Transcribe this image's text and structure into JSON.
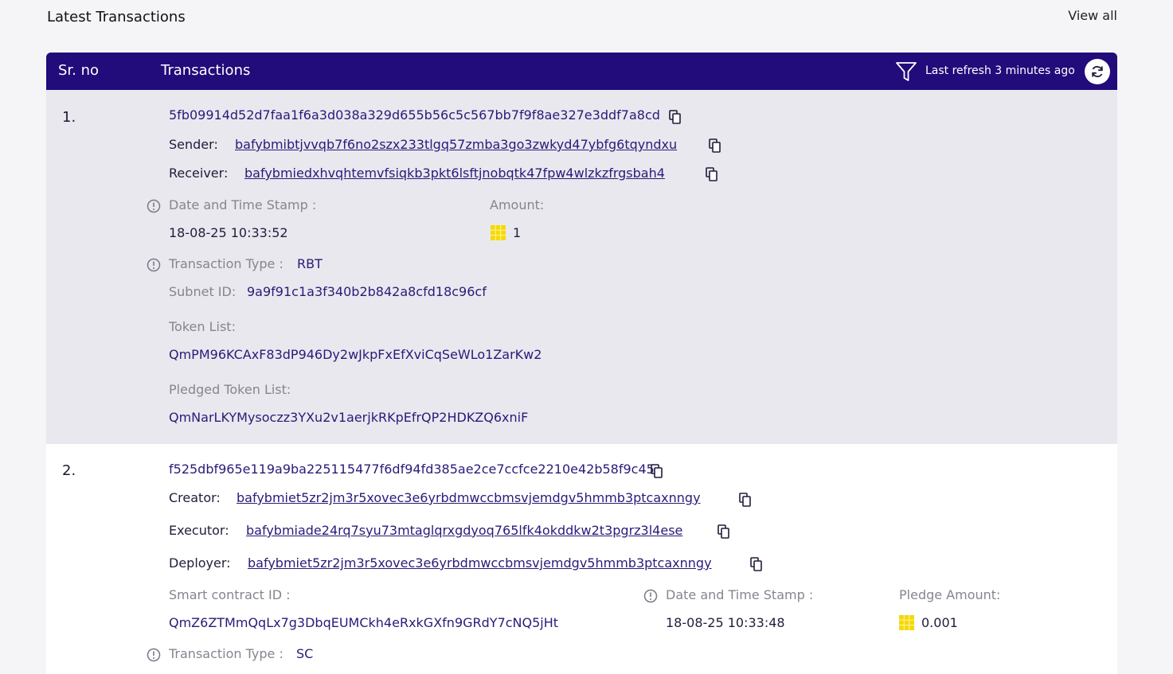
{
  "header": {
    "title": "Latest Transactions",
    "view_all": "View all"
  },
  "table": {
    "col_srno": "Sr. no",
    "col_transactions": "Transactions",
    "refresh_text": "Last refresh 3 minutes ago"
  },
  "rows": [
    {
      "srno": "1.",
      "hash": "5fb09914d52d7faa1f6a3d038a329d655b56c5c567bb7f9f8ae327e3ddf7a8cd",
      "sender_label": "Sender:",
      "sender": "bafybmibtjvvqb7f6no2szx233tlgq57zmba3go3zwkyd47ybfg6tqyndxu",
      "receiver_label": "Receiver:",
      "receiver": "bafybmiedxhvqhtemvfsiqkb3pkt6lsftjnobqtk47fpw4wlzkzfrgsbah4",
      "date_label": "Date and Time Stamp :",
      "date": "18-08-25 10:33:52",
      "amount_label": "Amount:",
      "amount": "1",
      "type_label": "Transaction Type :",
      "type": "RBT",
      "subnet_label": "Subnet ID:",
      "subnet": "9a9f91c1a3f340b2b842a8cfd18c96cf",
      "token_list_label": "Token List:",
      "token_list": "QmPM96KCAxF83dP946Dy2wJkpFxEfXviCqSeWLo1ZarKw2",
      "pledged_label": "Pledged Token List:",
      "pledged": "QmNarLKYMysoczz3YXu2v1aerjkRKpEfrQP2HDKZQ6xniF"
    },
    {
      "srno": "2.",
      "hash": "f525dbf965e119a9ba225115477f6df94fd385ae2ce7ccfce2210e42b58f9c45",
      "creator_label": "Creator:",
      "creator": "bafybmiet5zr2jm3r5xovec3e6yrbdmwccbmsvjemdgv5hmmb3ptcaxnngy",
      "executor_label": "Executor:",
      "executor": "bafybmiade24rq7syu73mtaglqrxgdyoq765lfk4okddkw2t3pgrz3l4ese",
      "deployer_label": "Deployer:",
      "deployer": "bafybmiet5zr2jm3r5xovec3e6yrbdmwccbmsvjemdgv5hmmb3ptcaxnngy",
      "sc_label": "Smart contract ID :",
      "sc": "QmZ6ZTMmQqLx7g3DbqEUMCkh4eRxkGXfn9GRdY7cNQ5jHt",
      "date_label": "Date and Time Stamp :",
      "date": "18-08-25 10:33:48",
      "pledge_label": "Pledge Amount:",
      "pledge": "0.001",
      "type_label": "Transaction Type :",
      "type": "SC"
    }
  ],
  "colors": {
    "header_bg": "#220b7a",
    "row_alt_bg": "#e9e8ef",
    "accent_text": "#2b1a78",
    "token_yellow": "#f5d90a"
  },
  "icons": [
    "filter-icon",
    "refresh-icon",
    "copy-icon",
    "info-icon",
    "token-icon"
  ]
}
